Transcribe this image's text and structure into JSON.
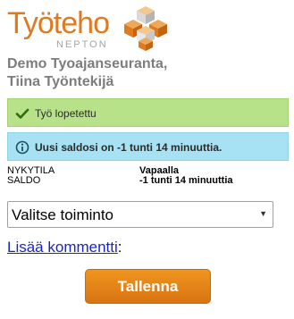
{
  "header": {
    "logo_text": "Työteho",
    "logo_sub": "NEPTON",
    "logo_icon": "cube-cluster-logo-icon"
  },
  "page": {
    "title_line1": "Demo Tyoajanseuranta,",
    "title_line2": "Tiina Työntekijä"
  },
  "alerts": {
    "success_icon": "checkmark-icon",
    "success_message": "Työ lopetettu",
    "info_icon": "info-icon",
    "info_message": "Uusi saldosi on -1 tunti 14 minuuttia."
  },
  "status": {
    "state_label": "NYKYTILA",
    "state_value": "Vapaalla",
    "balance_label": "SALDO",
    "balance_value": "-1 tunti 14 minuuttia"
  },
  "action_select": {
    "selected": "Valitse toiminto",
    "arrow": "▼"
  },
  "comment": {
    "link_label": "Lisää kommentti",
    "suffix": ":"
  },
  "buttons": {
    "save_label": "Tallenna"
  },
  "colors": {
    "brand_orange": "#e07a1f",
    "success_bg": "#b8e28a",
    "info_bg": "#a6e2f3",
    "link": "#1a25c8"
  }
}
